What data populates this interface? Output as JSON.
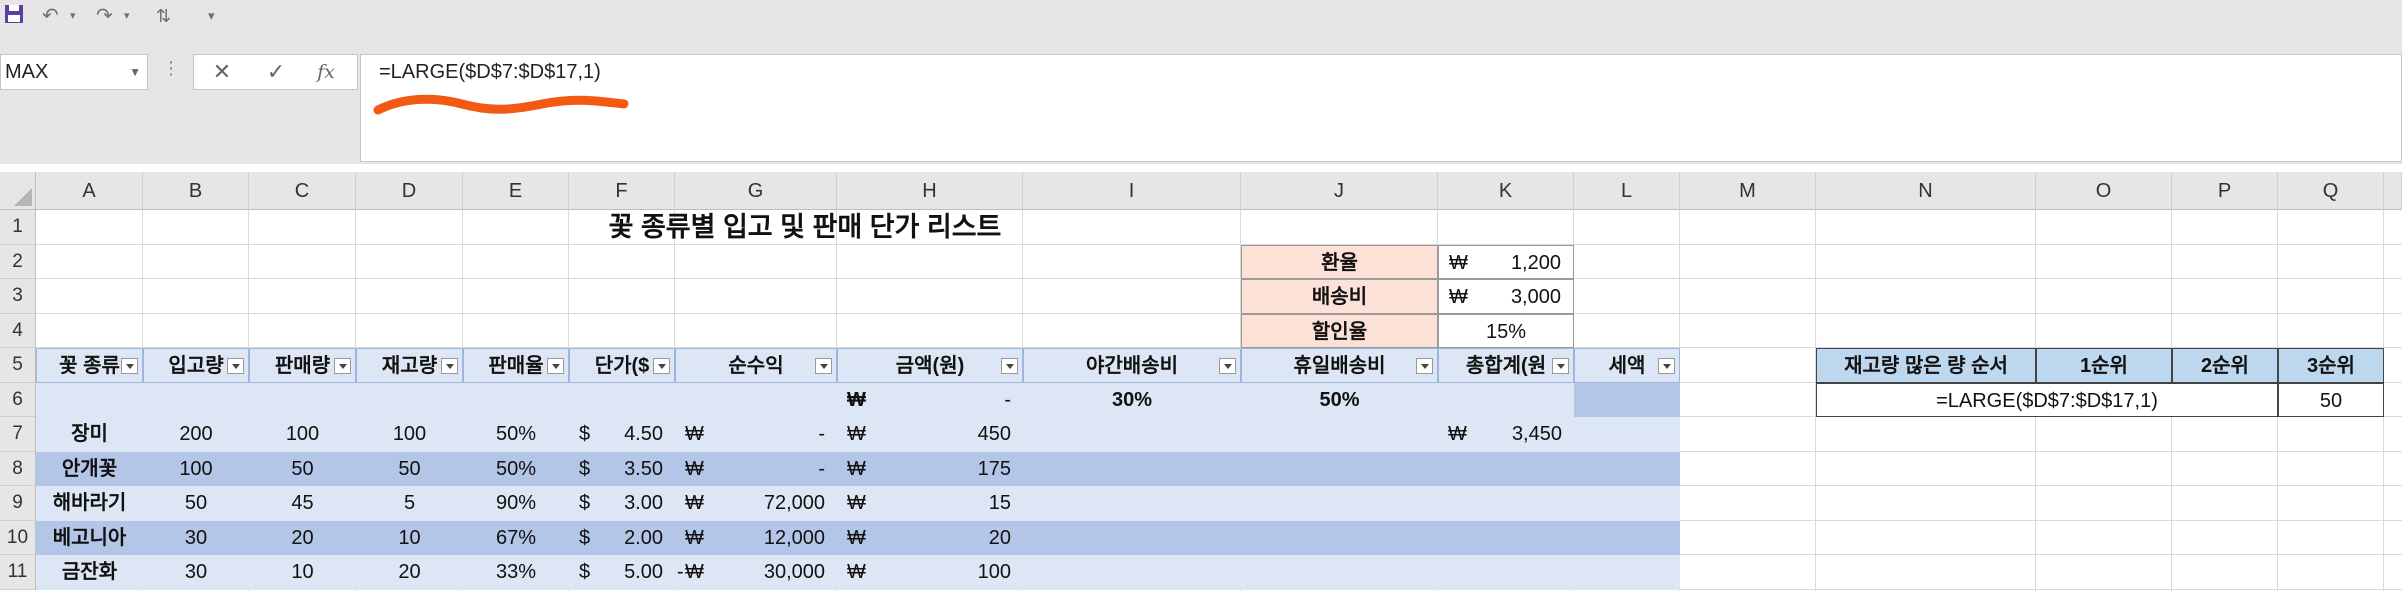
{
  "toolbar": {
    "icons": [
      "save-icon",
      "undo-icon",
      "redo-icon",
      "sort-icon",
      "customize-icon"
    ]
  },
  "name_box": {
    "value": "MAX"
  },
  "formula_bar": {
    "formula": "=LARGE($D$7:$D$17,1)",
    "cancel": "✕",
    "enter": "✓",
    "fx": "fx"
  },
  "columns": [
    "A",
    "B",
    "C",
    "D",
    "E",
    "F",
    "G",
    "H",
    "I",
    "J",
    "K",
    "L",
    "M",
    "N",
    "O",
    "P",
    "Q"
  ],
  "rows": [
    "1",
    "2",
    "3",
    "4",
    "5",
    "6",
    "7",
    "8",
    "9",
    "10",
    "11"
  ],
  "sheet": {
    "title": "꽃 종류별 입고 및 판매 단가 리스트",
    "info": [
      {
        "label": "환율",
        "currency": "₩",
        "value": "1,200"
      },
      {
        "label": "배송비",
        "currency": "₩",
        "value": "3,000"
      },
      {
        "label": "할인율",
        "currency": "",
        "value": "15%"
      }
    ],
    "headers": [
      "꽃 종류",
      "입고량",
      "판매량",
      "재고량",
      "판매율",
      "단가($",
      "순수익",
      "금액(원)",
      "야간배송비",
      "휴일배송비",
      "총합계(원",
      "세액"
    ],
    "row6": {
      "h_cur": "₩",
      "h_val": "-",
      "i": "30%",
      "j": "50%"
    },
    "data": [
      {
        "name": "장미",
        "in": "200",
        "sold": "100",
        "stock": "100",
        "rate": "50%",
        "price": "4.50",
        "profit": "-",
        "amount": "450",
        "total": "3,450"
      },
      {
        "name": "안개꽃",
        "in": "100",
        "sold": "50",
        "stock": "50",
        "rate": "50%",
        "price": "3.50",
        "profit": "-",
        "amount": "175",
        "total": ""
      },
      {
        "name": "해바라기",
        "in": "50",
        "sold": "45",
        "stock": "5",
        "rate": "90%",
        "price": "3.00",
        "profit": "72,000",
        "amount": "15",
        "total": ""
      },
      {
        "name": "베고니아",
        "in": "30",
        "sold": "20",
        "stock": "10",
        "rate": "67%",
        "price": "2.00",
        "profit": "12,000",
        "amount": "20",
        "total": ""
      },
      {
        "name": "금잔화",
        "in": "30",
        "sold": "10",
        "stock": "20",
        "rate": "33%",
        "price": "5.00",
        "profit": "30,000",
        "amount": "100",
        "total": "",
        "profit_neg": "-"
      }
    ],
    "dollar": "$",
    "won": "₩"
  },
  "ranking": {
    "title": "재고량 많은 량 순서",
    "headers": [
      "1순위",
      "2순위",
      "3순위"
    ],
    "formula": "=LARGE($D$7:$D$17,1)",
    "third": "50"
  },
  "colors": {
    "peach": "#fbe1d6",
    "band_light": "#dce6f4",
    "band_dark": "#b4c6e7",
    "rank_header": "#bdd7ee",
    "squiggle": "#f25a14"
  }
}
